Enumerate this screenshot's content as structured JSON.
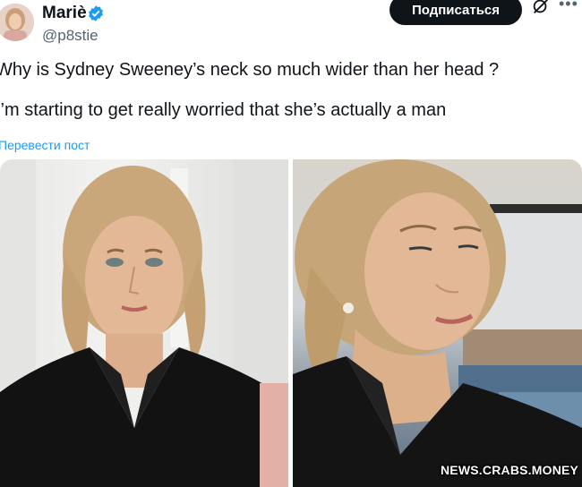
{
  "author": {
    "display_name": "Mariè",
    "handle": "@p8stie",
    "verified_icon": "verified-badge-icon"
  },
  "header": {
    "subscribe_label": "Подписаться",
    "grok_icon": "grok-icon",
    "more_icon": "more-icon"
  },
  "tweet": {
    "line1": "Why is Sydney Sweeney’s neck so much wider than her head ?",
    "line2": "I’m starting to get really worried that she’s actually a man",
    "translate_link": "Перевести пост"
  },
  "watermark": "NEWS.CRABS.MONEY",
  "colors": {
    "text": "#0f1419",
    "secondary": "#536471",
    "link": "#1d9bf0",
    "verified": "#1d9bf0",
    "button_bg": "#0f1419"
  }
}
